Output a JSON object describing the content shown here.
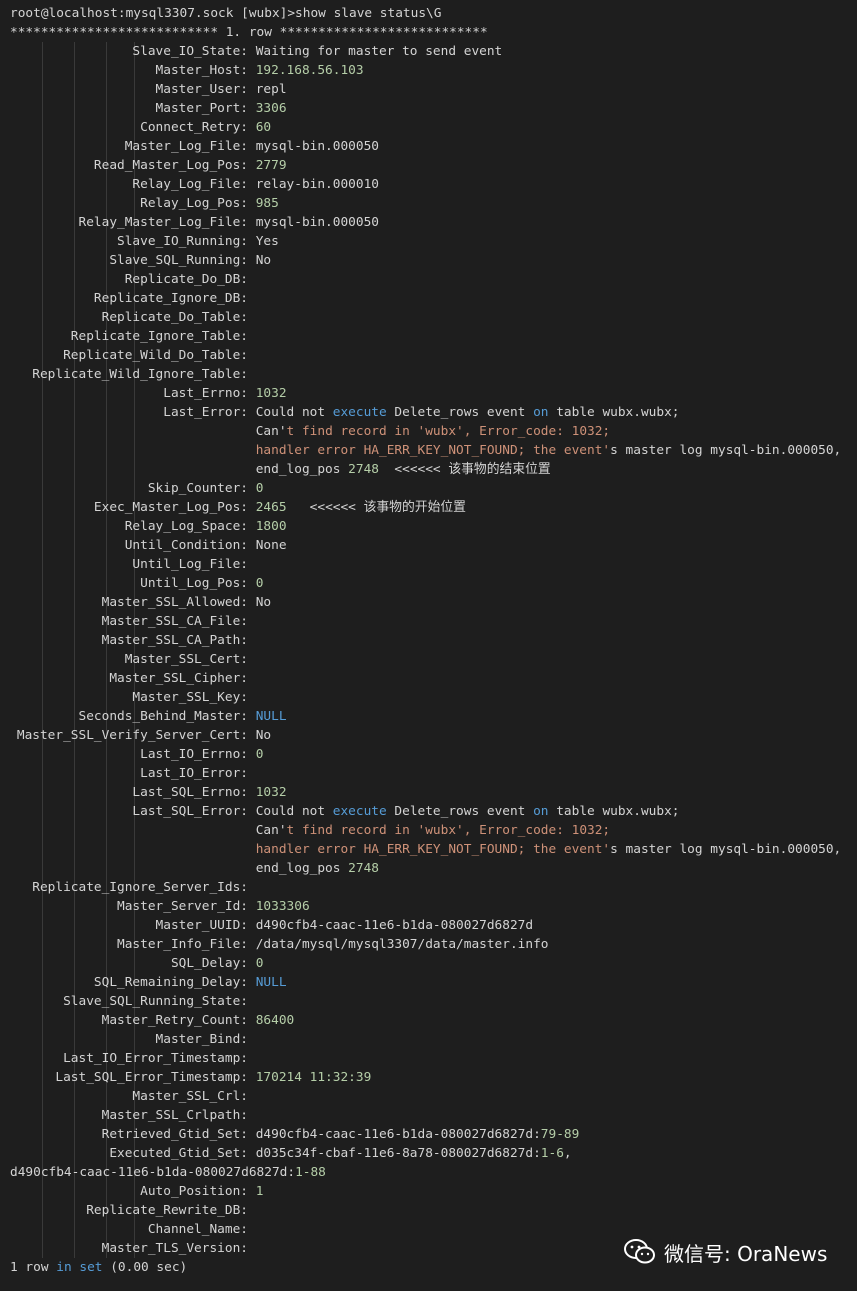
{
  "prompt_line": "root@localhost:mysql3307.sock [wubx]>show slave status\\G",
  "row_header": "*************************** 1. row ***************************",
  "fields": [
    {
      "label": "Slave_IO_State:",
      "parts": [
        {
          "t": "Waiting for master to send event",
          "c": "plain"
        }
      ]
    },
    {
      "label": "Master_Host:",
      "parts": [
        {
          "t": "192.168.56.103",
          "c": "num"
        }
      ]
    },
    {
      "label": "Master_User:",
      "parts": [
        {
          "t": "repl",
          "c": "plain"
        }
      ]
    },
    {
      "label": "Master_Port:",
      "parts": [
        {
          "t": "3306",
          "c": "num"
        }
      ]
    },
    {
      "label": "Connect_Retry:",
      "parts": [
        {
          "t": "60",
          "c": "num"
        }
      ]
    },
    {
      "label": "Master_Log_File:",
      "parts": [
        {
          "t": "mysql-bin.000050",
          "c": "plain"
        }
      ]
    },
    {
      "label": "Read_Master_Log_Pos:",
      "parts": [
        {
          "t": "2779",
          "c": "num"
        }
      ]
    },
    {
      "label": "Relay_Log_File:",
      "parts": [
        {
          "t": "relay-bin.000010",
          "c": "plain"
        }
      ]
    },
    {
      "label": "Relay_Log_Pos:",
      "parts": [
        {
          "t": "985",
          "c": "num"
        }
      ]
    },
    {
      "label": "Relay_Master_Log_File:",
      "parts": [
        {
          "t": "mysql-bin.000050",
          "c": "plain"
        }
      ]
    },
    {
      "label": "Slave_IO_Running:",
      "parts": [
        {
          "t": "Yes",
          "c": "plain"
        }
      ]
    },
    {
      "label": "Slave_SQL_Running:",
      "parts": [
        {
          "t": "No",
          "c": "plain"
        }
      ]
    },
    {
      "label": "Replicate_Do_DB:",
      "parts": []
    },
    {
      "label": "Replicate_Ignore_DB:",
      "parts": []
    },
    {
      "label": "Replicate_Do_Table:",
      "parts": []
    },
    {
      "label": "Replicate_Ignore_Table:",
      "parts": []
    },
    {
      "label": "Replicate_Wild_Do_Table:",
      "parts": []
    },
    {
      "label": "Replicate_Wild_Ignore_Table:",
      "parts": []
    },
    {
      "label": "Last_Errno:",
      "parts": [
        {
          "t": "1032",
          "c": "num"
        }
      ]
    },
    {
      "label": "Last_Error:",
      "parts": [
        {
          "t": "Could not ",
          "c": "plain"
        },
        {
          "t": "execute",
          "c": "kw"
        },
        {
          "t": " Delete_rows event ",
          "c": "plain"
        },
        {
          "t": "on",
          "c": "kw"
        },
        {
          "t": " table wubx.wubx;",
          "c": "plain"
        }
      ]
    },
    {
      "label": "",
      "parts": [
        {
          "t": "Can'",
          "c": "plain"
        },
        {
          "t": "t find record in 'wubx', Error_code: 1032;",
          "c": "str"
        }
      ]
    },
    {
      "label": "",
      "parts": [
        {
          "t": "handler error HA_ERR_KEY_NOT_FOUND; the event'",
          "c": "str"
        },
        {
          "t": "s master log mysql-bin.000050,",
          "c": "plain"
        }
      ]
    },
    {
      "label": "",
      "parts": [
        {
          "t": "end_log_pos ",
          "c": "plain"
        },
        {
          "t": "2748",
          "c": "num"
        },
        {
          "t": "  <<<<<< 该事物的结束位置",
          "c": "plain"
        }
      ]
    },
    {
      "label": "Skip_Counter:",
      "parts": [
        {
          "t": "0",
          "c": "num"
        }
      ]
    },
    {
      "label": "Exec_Master_Log_Pos:",
      "parts": [
        {
          "t": "2465",
          "c": "num"
        },
        {
          "t": "   <<<<<< 该事物的开始位置",
          "c": "plain"
        }
      ]
    },
    {
      "label": "Relay_Log_Space:",
      "parts": [
        {
          "t": "1800",
          "c": "num"
        }
      ]
    },
    {
      "label": "Until_Condition:",
      "parts": [
        {
          "t": "None",
          "c": "plain"
        }
      ]
    },
    {
      "label": "Until_Log_File:",
      "parts": []
    },
    {
      "label": "Until_Log_Pos:",
      "parts": [
        {
          "t": "0",
          "c": "num"
        }
      ]
    },
    {
      "label": "Master_SSL_Allowed:",
      "parts": [
        {
          "t": "No",
          "c": "plain"
        }
      ]
    },
    {
      "label": "Master_SSL_CA_File:",
      "parts": []
    },
    {
      "label": "Master_SSL_CA_Path:",
      "parts": []
    },
    {
      "label": "Master_SSL_Cert:",
      "parts": []
    },
    {
      "label": "Master_SSL_Cipher:",
      "parts": []
    },
    {
      "label": "Master_SSL_Key:",
      "parts": []
    },
    {
      "label": "Seconds_Behind_Master:",
      "parts": [
        {
          "t": "NULL",
          "c": "kw"
        }
      ]
    },
    {
      "label": "Master_SSL_Verify_Server_Cert:",
      "parts": [
        {
          "t": "No",
          "c": "plain"
        }
      ]
    },
    {
      "label": "Last_IO_Errno:",
      "parts": [
        {
          "t": "0",
          "c": "num"
        }
      ]
    },
    {
      "label": "Last_IO_Error:",
      "parts": []
    },
    {
      "label": "Last_SQL_Errno:",
      "parts": [
        {
          "t": "1032",
          "c": "num"
        }
      ]
    },
    {
      "label": "Last_SQL_Error:",
      "parts": [
        {
          "t": "Could not ",
          "c": "plain"
        },
        {
          "t": "execute",
          "c": "kw"
        },
        {
          "t": " Delete_rows event ",
          "c": "plain"
        },
        {
          "t": "on",
          "c": "kw"
        },
        {
          "t": " table wubx.wubx;",
          "c": "plain"
        }
      ]
    },
    {
      "label": "",
      "parts": [
        {
          "t": "Can'",
          "c": "plain"
        },
        {
          "t": "t find record in 'wubx', Error_code: 1032;",
          "c": "str"
        }
      ]
    },
    {
      "label": "",
      "parts": [
        {
          "t": "handler error HA_ERR_KEY_NOT_FOUND; the event'",
          "c": "str"
        },
        {
          "t": "s master log mysql-bin.000050,",
          "c": "plain"
        }
      ]
    },
    {
      "label": "",
      "parts": [
        {
          "t": "end_log_pos ",
          "c": "plain"
        },
        {
          "t": "2748",
          "c": "num"
        }
      ]
    },
    {
      "label": "Replicate_Ignore_Server_Ids:",
      "parts": []
    },
    {
      "label": "Master_Server_Id:",
      "parts": [
        {
          "t": "1033306",
          "c": "num"
        }
      ]
    },
    {
      "label": "Master_UUID:",
      "parts": [
        {
          "t": "d490cfb4-caac-11e6-b1da-080027d6827d",
          "c": "plain"
        }
      ]
    },
    {
      "label": "Master_Info_File:",
      "parts": [
        {
          "t": "/data/mysql/mysql3307/data/master.info",
          "c": "plain"
        }
      ]
    },
    {
      "label": "SQL_Delay:",
      "parts": [
        {
          "t": "0",
          "c": "num"
        }
      ]
    },
    {
      "label": "SQL_Remaining_Delay:",
      "parts": [
        {
          "t": "NULL",
          "c": "kw"
        }
      ]
    },
    {
      "label": "Slave_SQL_Running_State:",
      "parts": []
    },
    {
      "label": "Master_Retry_Count:",
      "parts": [
        {
          "t": "86400",
          "c": "num"
        }
      ]
    },
    {
      "label": "Master_Bind:",
      "parts": []
    },
    {
      "label": "Last_IO_Error_Timestamp:",
      "parts": []
    },
    {
      "label": "Last_SQL_Error_Timestamp:",
      "parts": [
        {
          "t": "170214 11:32:39",
          "c": "num"
        }
      ]
    },
    {
      "label": "Master_SSL_Crl:",
      "parts": []
    },
    {
      "label": "Master_SSL_Crlpath:",
      "parts": []
    },
    {
      "label": "Retrieved_Gtid_Set:",
      "parts": [
        {
          "t": "d490cfb4-caac-11e6-b1da-080027d6827d:",
          "c": "plain"
        },
        {
          "t": "79-89",
          "c": "num"
        }
      ]
    },
    {
      "label": "Executed_Gtid_Set:",
      "parts": [
        {
          "t": "d035c34f-cbaf-11e6-8a78-080027d6827d:",
          "c": "plain"
        },
        {
          "t": "1-6",
          "c": "num"
        },
        {
          "t": ",",
          "c": "plain"
        }
      ]
    },
    {
      "label": null,
      "parts": [
        {
          "t": "d490cfb4-caac-11e6-b1da-080027d6827d:",
          "c": "plain"
        },
        {
          "t": "1-88",
          "c": "num"
        }
      ]
    },
    {
      "label": "Auto_Position:",
      "parts": [
        {
          "t": "1",
          "c": "num"
        }
      ]
    },
    {
      "label": "Replicate_Rewrite_DB:",
      "parts": []
    },
    {
      "label": "Channel_Name:",
      "parts": []
    },
    {
      "label": "Master_TLS_Version:",
      "parts": []
    }
  ],
  "footer_parts": [
    {
      "t": "1 row ",
      "c": "plain"
    },
    {
      "t": "in",
      "c": "kw"
    },
    {
      "t": " ",
      "c": "plain"
    },
    {
      "t": "set",
      "c": "kw"
    },
    {
      "t": " (0.00 sec)",
      "c": "plain"
    }
  ],
  "watermark": {
    "text": "微信号: OraNews",
    "icon": "wechat-icon"
  },
  "colors": {
    "background": "#1e1e1e",
    "text": "#d4d4d4",
    "number": "#b5cea8",
    "keyword": "#569cd6",
    "string": "#ce9178"
  }
}
